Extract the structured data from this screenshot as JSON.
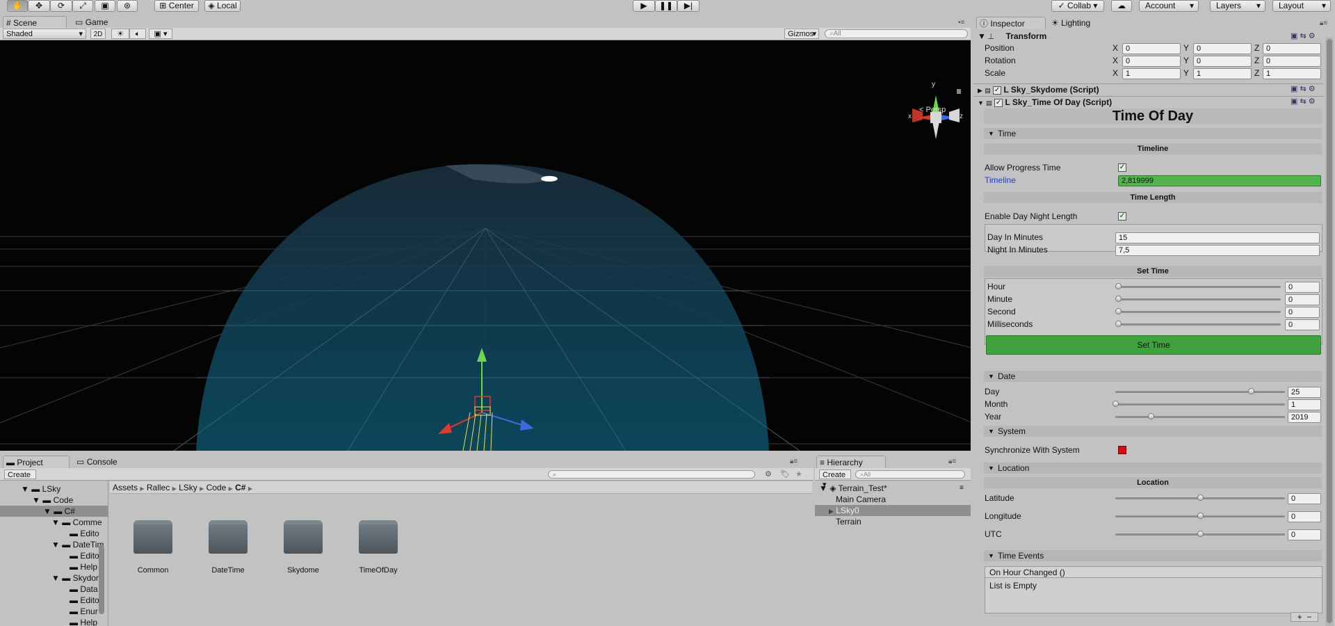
{
  "toolbar": {
    "pivot": "Center",
    "space": "Local",
    "collab": "Collab",
    "account": "Account",
    "layers": "Layers",
    "layout": "Layout"
  },
  "scene_tabs": [
    "Scene",
    "Game"
  ],
  "scene_toolbar": {
    "shading": "Shaded",
    "mode_2d": "2D",
    "gizmos": "Gizmos",
    "search_placeholder": "All"
  },
  "scene_view": {
    "projection": "Persp",
    "gizmo_axes": {
      "x": "x",
      "y": "y",
      "z": "z"
    }
  },
  "project": {
    "tabs": [
      "Project",
      "Console"
    ],
    "create": "Create",
    "tree": [
      "LSky",
      "Code",
      "C#",
      "Common",
      "Editor",
      "DateTime",
      "Editor",
      "Help",
      "Skydome",
      "Data",
      "Editor",
      "Enum",
      "Help"
    ],
    "tree_visible": [
      "LSky",
      "Code",
      "C#",
      "Comme",
      "Edito",
      "DateTim",
      "Edito",
      "Help",
      "Skydon",
      "Data",
      "Edito",
      "Enur",
      "Help"
    ],
    "breadcrumb": [
      "Assets",
      "Rallec",
      "LSky",
      "Code",
      "C#"
    ],
    "folders": [
      "Common",
      "DateTime",
      "Skydome",
      "TimeOfDay"
    ]
  },
  "hierarchy": {
    "tab": "Hierarchy",
    "create": "Create",
    "search_placeholder": "All",
    "scene": "Terrain_Test*",
    "items": [
      "Main Camera",
      "LSky0",
      "Terrain"
    ]
  },
  "inspector": {
    "tabs": [
      "Inspector",
      "Lighting"
    ],
    "transform": {
      "title": "Transform",
      "rows": [
        {
          "label": "Position",
          "x": "0",
          "y": "0",
          "z": "0"
        },
        {
          "label": "Rotation",
          "x": "0",
          "y": "0",
          "z": "0"
        },
        {
          "label": "Scale",
          "x": "1",
          "y": "1",
          "z": "1"
        }
      ],
      "axes": [
        "X",
        "Y",
        "Z"
      ]
    },
    "skydome_script": "L Sky_Skydome (Script)",
    "tod_script": "L Sky_Time Of Day (Script)",
    "tod_title": "Time Of Day",
    "time_section": "Time",
    "timeline_header": "Timeline",
    "allow_progress_label": "Allow Progress Time",
    "timeline_label": "Timeline",
    "timeline_value": "2,819999",
    "time_length_header": "Time Length",
    "enable_day_night_label": "Enable Day Night Length",
    "day_minutes_label": "Day In Minutes",
    "day_minutes_value": "15",
    "night_minutes_label": "Night In Minutes",
    "night_minutes_value": "7,5",
    "set_time_header": "Set Time",
    "set_time_rows": [
      {
        "label": "Hour",
        "value": "0",
        "fraction": 0
      },
      {
        "label": "Minute",
        "value": "0",
        "fraction": 0
      },
      {
        "label": "Second",
        "value": "0",
        "fraction": 0
      },
      {
        "label": "Milliseconds",
        "value": "0",
        "fraction": 0
      }
    ],
    "set_time_button": "Set Time",
    "date_section": "Date",
    "date_rows": [
      {
        "label": "Day",
        "value": "25",
        "fraction": 0.8
      },
      {
        "label": "Month",
        "value": "1",
        "fraction": 0
      },
      {
        "label": "Year",
        "value": "2019",
        "fraction": 0.21
      }
    ],
    "system_section": "System",
    "sync_label": "Synchronize With System",
    "location_section": "Location",
    "location_header": "Location",
    "location_rows": [
      {
        "label": "Latitude",
        "value": "0",
        "fraction": 0.5
      },
      {
        "label": "Longitude",
        "value": "0",
        "fraction": 0.5
      },
      {
        "label": "UTC",
        "value": "0",
        "fraction": 0.5
      }
    ],
    "time_events_section": "Time Events",
    "on_hour_changed": "On Hour Changed ()",
    "list_empty": "List is Empty"
  },
  "colors": {
    "accent_green": "#3fa23c",
    "sync_red": "#d01010"
  }
}
